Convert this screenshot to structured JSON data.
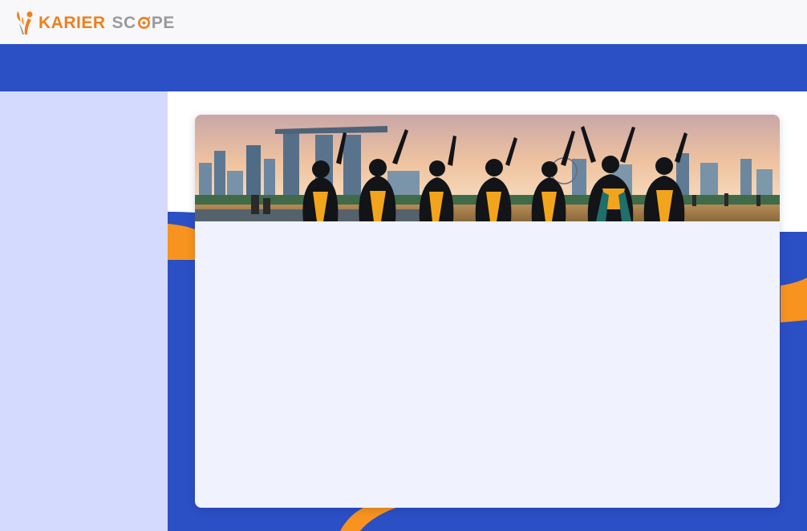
{
  "header": {
    "logo": {
      "word1": "KARIER",
      "word2_prefix": "SC",
      "word2_suffix": "PE",
      "icon": "person-flame-logo-icon",
      "accent_color": "#ef7f1a",
      "secondary_color": "#9a9a9a"
    }
  },
  "navbar": {
    "background": "#2b4fc4"
  },
  "sidebar": {
    "background": "#d4dafd"
  },
  "main": {
    "background_shape_colors": [
      "#2b4fc4",
      "#f7931e"
    ],
    "card": {
      "banner_image": "graduates-celebrating-city-skyline-photo",
      "background": "#f0f2fd"
    }
  }
}
